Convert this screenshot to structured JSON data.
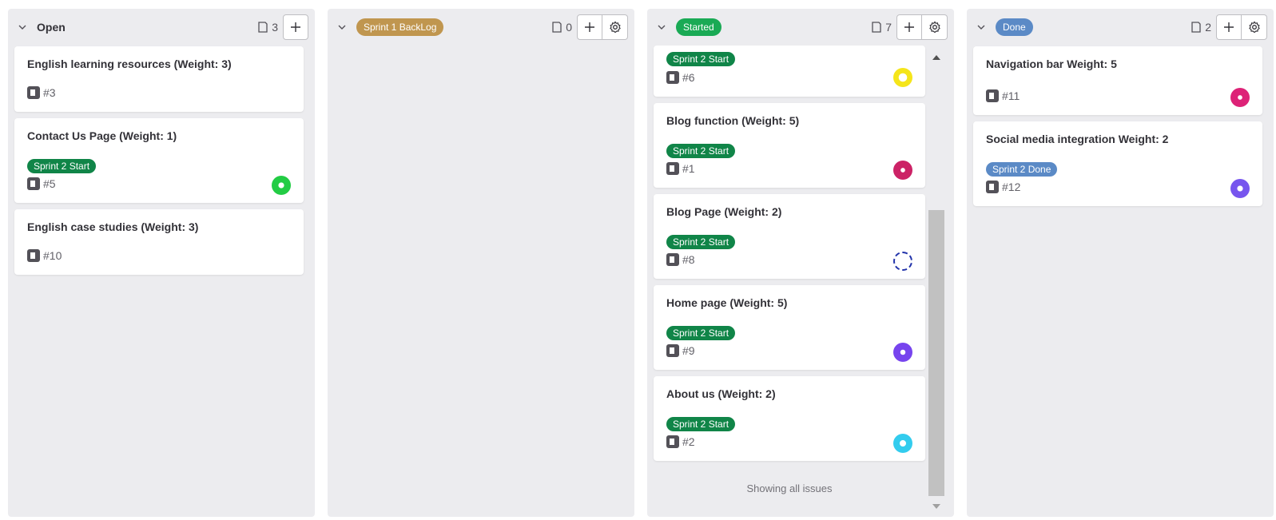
{
  "colors": {
    "green_label": "#108548",
    "backlog_label": "#c0964f",
    "started_label": "#1aaa55",
    "done_label": "#5b8ac6",
    "done_card_label": "#5b8ac6"
  },
  "columns": [
    {
      "title": "Open",
      "count": "3",
      "cards": [
        {
          "title": "English learning resources (Weight: 3)",
          "ref": "#3"
        },
        {
          "title": "Contact Us Page (Weight: 1)",
          "label": "Sprint 2 Start",
          "ref": "#5",
          "avatar_color": "#22cc44"
        },
        {
          "title": "English case studies (Weight: 3)",
          "ref": "#10"
        }
      ]
    },
    {
      "title": "Sprint 1 BackLog",
      "count": "0",
      "cards": []
    },
    {
      "title": "Started",
      "count": "7",
      "cards": [
        {
          "label": "Sprint 2 Start",
          "ref": "#6",
          "avatar_color": "#f5e51a"
        },
        {
          "title": "Blog function (Weight: 5)",
          "label": "Sprint 2 Start",
          "ref": "#1",
          "avatar_color": "#cc2266"
        },
        {
          "title": "Blog Page (Weight: 2)",
          "label": "Sprint 2 Start",
          "ref": "#8",
          "avatar_color": "#2233aa"
        },
        {
          "title": "Home page (Weight: 5)",
          "label": "Sprint 2 Start",
          "ref": "#9",
          "avatar_color": "#7744ee"
        },
        {
          "title": "About us (Weight: 2)",
          "label": "Sprint 2 Start",
          "ref": "#2",
          "avatar_color": "#33ccee"
        }
      ],
      "footer": "Showing all issues"
    },
    {
      "title": "Done",
      "count": "2",
      "cards": [
        {
          "title": "Navigation bar Weight: 5",
          "ref": "#11",
          "avatar_color": "#dd2277"
        },
        {
          "title": "Social media integration Weight: 2",
          "label": "Sprint 2 Done",
          "ref": "#12",
          "avatar_color": "#7755ee"
        }
      ]
    }
  ]
}
